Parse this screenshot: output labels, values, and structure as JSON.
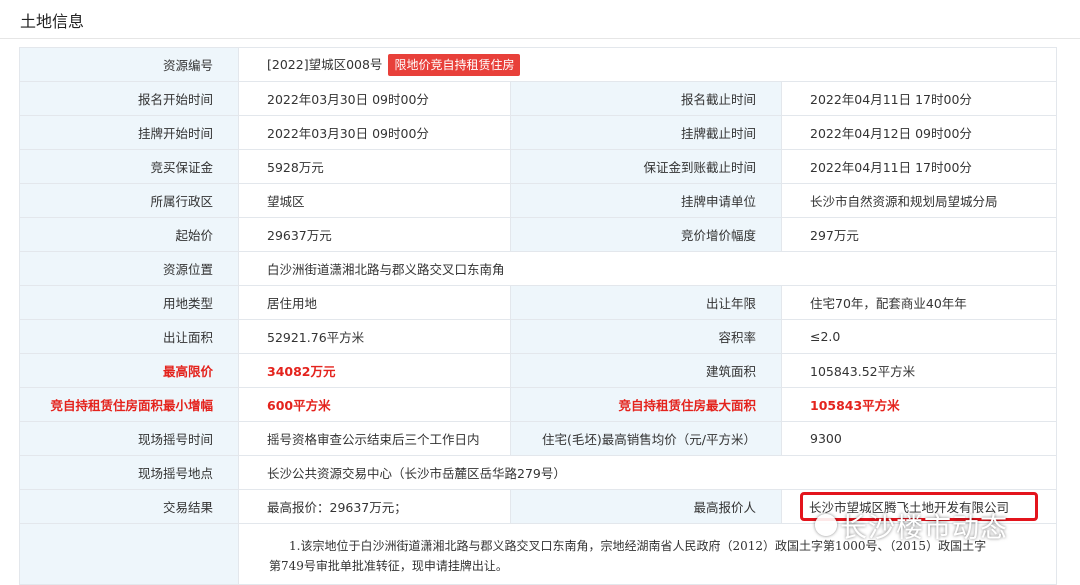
{
  "page_title": "土地信息",
  "rows": [
    {
      "type": "span",
      "l1": "资源编号",
      "v1": "[2022]望城区008号",
      "badge": "限地价竞自持租赁住房"
    },
    {
      "type": "pair",
      "l1": "报名开始时间",
      "v1": "2022年03月30日 09时00分",
      "l2": "报名截止时间",
      "v2": "2022年04月11日 17时00分"
    },
    {
      "type": "pair",
      "l1": "挂牌开始时间",
      "v1": "2022年03月30日 09时00分",
      "l2": "挂牌截止时间",
      "v2": "2022年04月12日 09时00分"
    },
    {
      "type": "pair",
      "l1": "竞买保证金",
      "v1": "5928万元",
      "l2": "保证金到账截止时间",
      "v2": "2022年04月11日 17时00分"
    },
    {
      "type": "pair",
      "l1": "所属行政区",
      "v1": "望城区",
      "l2": "挂牌申请单位",
      "v2": "长沙市自然资源和规划局望城分局"
    },
    {
      "type": "pair",
      "l1": "起始价",
      "v1": "29637万元",
      "l2": "竞价增价幅度",
      "v2": "297万元"
    },
    {
      "type": "span",
      "l1": "资源位置",
      "v1": "白沙洲街道潇湘北路与郡义路交叉口东南角"
    },
    {
      "type": "pair",
      "l1": "用地类型",
      "v1": "居住用地",
      "l2": "出让年限",
      "v2": "住宅70年，配套商业40年年"
    },
    {
      "type": "pair",
      "l1": "出让面积",
      "v1": "52921.76平方米",
      "l2": "容积率",
      "v2": "≤2.0"
    },
    {
      "type": "pair",
      "l1": "最高限价",
      "v1": "34082万元",
      "l2": "建筑面积",
      "v2": "105843.52平方米",
      "red1": true
    },
    {
      "type": "pair",
      "l1": "竞自持租赁住房面积最小增幅",
      "v1": "600平方米",
      "l2": "竞自持租赁住房最大面积",
      "v2": "105843平方米",
      "red1": true,
      "red2": true
    },
    {
      "type": "pair",
      "l1": "现场摇号时间",
      "v1": "摇号资格审查公示结束后三个工作日内",
      "l2": "住宅(毛坯)最高销售均价（元/平方米）",
      "v2": "9300"
    },
    {
      "type": "span",
      "l1": "现场摇号地点",
      "v1": "长沙公共资源交易中心（长沙市岳麓区岳华路279号）"
    },
    {
      "type": "pair",
      "l1": "交易结果",
      "v1": "最高报价：29637万元；",
      "l2": "最高报价人",
      "v2": "长沙市望城区腾飞土地开发有限公司",
      "box2": true
    }
  ],
  "note": {
    "line1": "1.该宗地位于白沙洲街道潇湘北路与郡义路交叉口东南角，宗地经湖南省人民政府（2012）政国土字第1000号、（2015）政国土字",
    "line2": "第749号审批单批准转征，现申请挂牌出让。"
  },
  "watermark": "长沙楼市动态"
}
